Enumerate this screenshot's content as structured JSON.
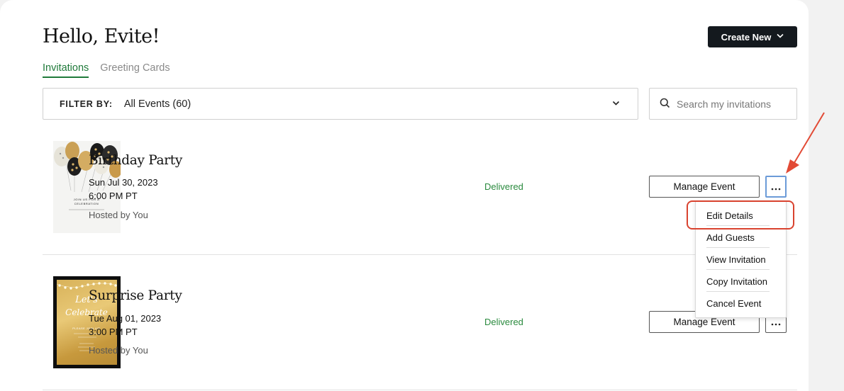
{
  "header": {
    "greeting": "Hello, Evite!",
    "create_label": "Create New"
  },
  "tabs": [
    {
      "label": "Invitations",
      "active": true
    },
    {
      "label": "Greeting Cards",
      "active": false
    }
  ],
  "filter": {
    "label": "FILTER BY:",
    "value": "All Events (60)"
  },
  "search": {
    "placeholder": "Search my invitations"
  },
  "events": [
    {
      "name": "Birthday Party",
      "date": "Sun Jul 30, 2023",
      "time": "6:00 PM PT",
      "host": "Hosted by You",
      "status": "Delivered",
      "manage_label": "Manage Event",
      "card_text": "JOIN US FOR A CELEBRATION"
    },
    {
      "name": "Surprise Party",
      "date": "Tue Aug 01, 2023",
      "time": "3:00 PM PT",
      "host": "Hosted by You",
      "status": "Delivered",
      "manage_label": "Manage Event",
      "card_text": "Let's Celebrate",
      "card_subtext": "PLEASE JOIN US!"
    }
  ],
  "menu": {
    "items": [
      "Edit Details",
      "Add Guests",
      "View Invitation",
      "Copy Invitation",
      "Cancel Event"
    ]
  },
  "colors": {
    "accent_green": "#1f7a3a",
    "status_green": "#2a8a3e",
    "annotation_red": "#d9432f",
    "dark_button": "#14191e"
  }
}
